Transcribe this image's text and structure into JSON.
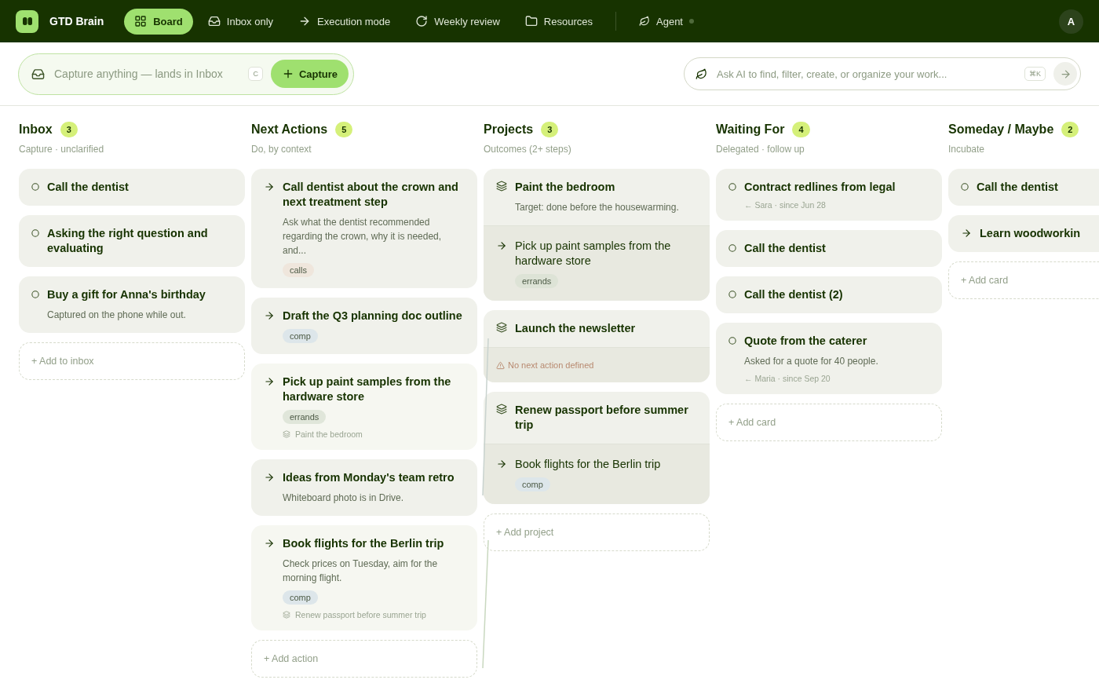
{
  "nav": {
    "brand": "GTD Brain",
    "tabs": [
      {
        "label": "Board",
        "selected": true
      },
      {
        "label": "Inbox only",
        "selected": false
      },
      {
        "label": "Execution mode",
        "selected": false
      },
      {
        "label": "Weekly review",
        "selected": false
      },
      {
        "label": "Resources",
        "selected": false
      }
    ],
    "agent": {
      "label": "Agent",
      "online": false
    },
    "avatar": "A"
  },
  "capture": {
    "placeholder": "Capture anything — lands in Inbox",
    "shortcut": "C",
    "button": "Capture"
  },
  "ask": {
    "placeholder": "Ask AI to find, filter, create, or organize your work...",
    "shortcut": "⌘K"
  },
  "columns": [
    {
      "title": "Inbox",
      "count": "3",
      "subtitle": "Capture · unclarified",
      "add": "+ Add to inbox",
      "cards": [
        {
          "kind": "inbox",
          "title": "Call the dentist"
        },
        {
          "kind": "inbox",
          "title": "Asking the right question and evaluating"
        },
        {
          "kind": "inbox",
          "title": "Buy a gift for Anna's birthday",
          "note": "Captured on the phone while out."
        }
      ]
    },
    {
      "title": "Next Actions",
      "count": "5",
      "subtitle": "Do, by context",
      "add": "+ Add action",
      "cards": [
        {
          "kind": "action",
          "title": "Call dentist about the crown and next treatment step",
          "note": "Ask what the dentist recommended regarding the crown, why it is needed, and...",
          "tag": {
            "label": "calls",
            "color": "#efe6dc"
          }
        },
        {
          "kind": "action",
          "title": "Draft the Q3 planning doc outline",
          "tag": {
            "label": "comp",
            "color": "#dde6ea"
          }
        },
        {
          "kind": "action",
          "title": "Pick up paint samples from the hardware store",
          "tag": {
            "label": "errands",
            "color": "#e0e6da"
          },
          "project": "Paint the bedroom"
        },
        {
          "kind": "action",
          "title": "Ideas from Monday's team retro",
          "note": "Whiteboard photo is in Drive."
        },
        {
          "kind": "action",
          "title": "Book flights for the Berlin trip",
          "note": "Check prices on Tuesday, aim for the morning flight.",
          "tag": {
            "label": "comp",
            "color": "#dde6ea"
          },
          "project": "Renew passport before summer trip"
        }
      ]
    },
    {
      "title": "Projects",
      "count": "3",
      "subtitle": "Outcomes (2+ steps)",
      "add": "+ Add project",
      "cards": [
        {
          "kind": "project",
          "title": "Paint the bedroom",
          "note": "Target: done before the housewarming.",
          "next": {
            "kind": "action",
            "title": "Pick up paint samples from the hardware store",
            "tag": {
              "label": "errands",
              "color": "#dde3d6"
            }
          }
        },
        {
          "kind": "project",
          "title": "Launch the newsletter",
          "next": {
            "kind": "warning",
            "title": "No next action defined"
          }
        },
        {
          "kind": "project",
          "title": "Renew passport before summer trip",
          "next": {
            "kind": "action",
            "title": "Book flights for the Berlin trip",
            "tag": {
              "label": "comp",
              "color": "#dde6ea"
            }
          }
        }
      ]
    },
    {
      "title": "Waiting For",
      "count": "4",
      "subtitle": "Delegated · follow up",
      "add": "+ Add card",
      "cards": [
        {
          "kind": "inbox",
          "title": "Contract redlines from legal",
          "meta": "← Sara · since Jun 28"
        },
        {
          "kind": "inbox",
          "title": "Call the dentist"
        },
        {
          "kind": "inbox",
          "title": "Call the dentist (2)"
        },
        {
          "kind": "inbox",
          "title": "Quote from the caterer",
          "note": "Asked for a quote for 40 people.",
          "meta": "← Maria · since Sep 20"
        }
      ]
    },
    {
      "title": "Someday / Maybe",
      "count": "2",
      "subtitle": "Incubate",
      "add": "+ Add card",
      "cards": [
        {
          "kind": "inbox",
          "title": "Call the dentist"
        },
        {
          "kind": "action",
          "title": "Learn woodworkin"
        }
      ]
    }
  ]
}
